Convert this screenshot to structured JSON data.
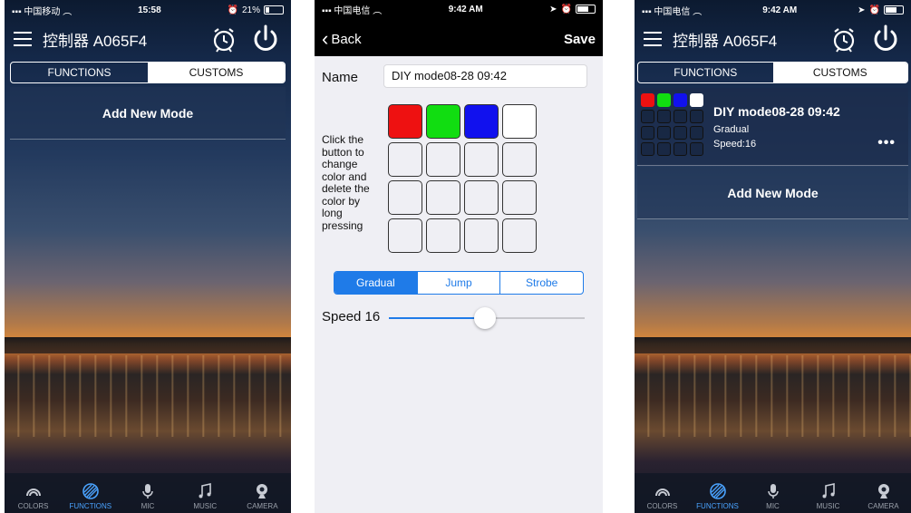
{
  "screen1": {
    "status": {
      "carrier": "中国移动",
      "time": "15:58",
      "battery": "21%"
    },
    "header": {
      "title": "控制器 A065F4"
    },
    "segments": {
      "functions": "FUNCTIONS",
      "customs": "CUSTOMS",
      "selected": "customs"
    },
    "add_mode": "Add New Mode",
    "tabs": [
      {
        "label": "COLORS",
        "icon": "colors-icon",
        "active": false
      },
      {
        "label": "FUNCTIONS",
        "icon": "functions-icon",
        "active": true
      },
      {
        "label": "MIC",
        "icon": "mic-icon",
        "active": false
      },
      {
        "label": "MUSIC",
        "icon": "music-icon",
        "active": false
      },
      {
        "label": "CAMERA",
        "icon": "camera-icon",
        "active": false
      }
    ]
  },
  "screen2": {
    "status": {
      "carrier": "中国电信",
      "time": "9:42 AM"
    },
    "nav": {
      "back": "Back",
      "save": "Save"
    },
    "name_label": "Name",
    "name_value": "DIY mode08-28 09:42",
    "instructions": "Click the button to change color and delete the color by long pressing",
    "colors": [
      "#ee1111",
      "#11dd11",
      "#1111ee",
      "#ffffff"
    ],
    "empty_slots": 12,
    "modes": [
      "Gradual",
      "Jump",
      "Strobe"
    ],
    "selected_mode": "Gradual",
    "speed_label": "Speed 16",
    "speed_fraction": 0.49
  },
  "screen3": {
    "status": {
      "carrier": "中国电信",
      "time": "9:42 AM"
    },
    "header": {
      "title": "控制器 A065F4"
    },
    "segments": {
      "functions": "FUNCTIONS",
      "customs": "CUSTOMS",
      "selected": "customs"
    },
    "card": {
      "title": "DIY mode08-28 09:42",
      "mode": "Gradual",
      "speed": "Speed:16",
      "more": "•••",
      "colors": [
        "#ee1111",
        "#11dd11",
        "#1111ee",
        "#ffffff"
      ]
    },
    "add_mode": "Add New Mode",
    "tabs": [
      {
        "label": "COLORS",
        "icon": "colors-icon",
        "active": false
      },
      {
        "label": "FUNCTIONS",
        "icon": "functions-icon",
        "active": true
      },
      {
        "label": "MIC",
        "icon": "mic-icon",
        "active": false
      },
      {
        "label": "MUSIC",
        "icon": "music-icon",
        "active": false
      },
      {
        "label": "CAMERA",
        "icon": "camera-icon",
        "active": false
      }
    ]
  }
}
